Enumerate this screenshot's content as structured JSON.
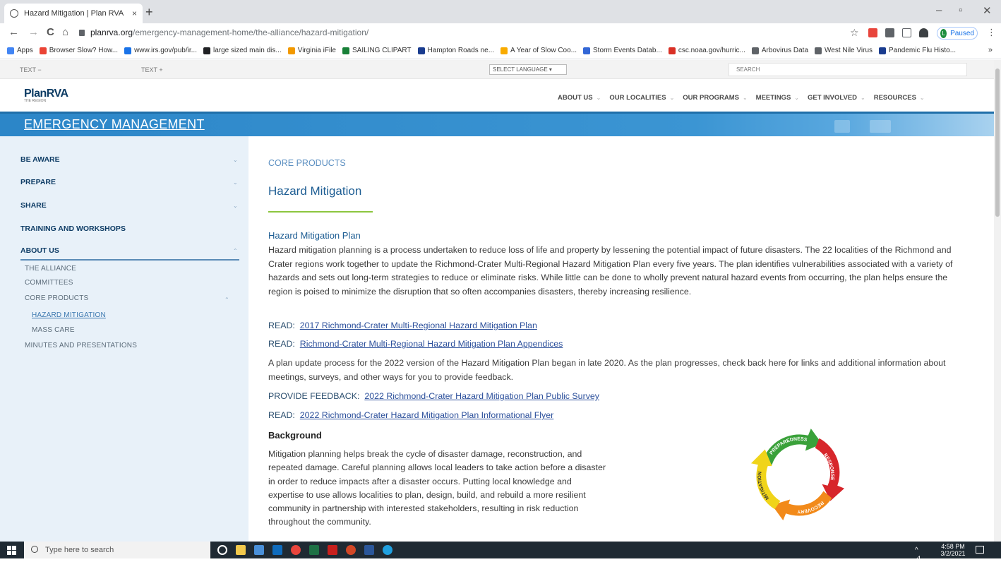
{
  "browser": {
    "tab_title": "Hazard Mitigation | Plan RVA",
    "tab_close": "×",
    "new_tab": "+",
    "window_controls": [
      "–",
      "▫",
      "✕"
    ],
    "nav": {
      "back": "←",
      "forward": "→",
      "reload": "C",
      "home": "⌂"
    },
    "url_host": "planrva.org",
    "url_path": "/emergency-management-home/the-alliance/hazard-mitigation/",
    "star": "☆",
    "profile_initial": "L",
    "profile_label": "Paused",
    "menu": "⋮",
    "bookmarks": [
      {
        "label": "Apps",
        "color": "#4285f4"
      },
      {
        "label": "Browser Slow? How...",
        "color": "#ea4335"
      },
      {
        "label": "www.irs.gov/pub/ir...",
        "color": "#1a73e8"
      },
      {
        "label": "large sized main dis...",
        "color": "#202124"
      },
      {
        "label": "Virginia iFile",
        "color": "#f29900"
      },
      {
        "label": "SAILING CLIPART",
        "color": "#188038"
      },
      {
        "label": "Hampton Roads ne...",
        "color": "#1a3c8f"
      },
      {
        "label": "A Year of Slow Coo...",
        "color": "#f9ab00"
      },
      {
        "label": "Storm Events Datab...",
        "color": "#3367d6"
      },
      {
        "label": "csc.noaa.gov/hurric...",
        "color": "#d93025"
      },
      {
        "label": "Arbovirus Data",
        "color": "#5f6368"
      },
      {
        "label": "West Nile Virus",
        "color": "#5f6368"
      },
      {
        "label": "Pandemic Flu Histo...",
        "color": "#1a3c8f"
      }
    ],
    "bookmarks_more": "»"
  },
  "utility": {
    "text_minus": "TEXT  −",
    "text_plus": "TEXT  +",
    "language": "SELECT LANGUAGE ▾",
    "search_placeholder": "SEARCH"
  },
  "header": {
    "logo": "PlanRVA",
    "logo_tagline": "THE REGION",
    "nav": [
      {
        "label": "ABOUT US",
        "caret": "⌄"
      },
      {
        "label": "OUR LOCALITIES",
        "caret": "⌄"
      },
      {
        "label": "OUR PROGRAMS",
        "caret": "⌄"
      },
      {
        "label": "MEETINGS",
        "caret": "⌄"
      },
      {
        "label": "GET INVOLVED",
        "caret": "⌄"
      },
      {
        "label": "RESOURCES",
        "caret": "⌄"
      }
    ]
  },
  "banner": {
    "title": "EMERGENCY MANAGEMENT"
  },
  "sidebar": {
    "sections": [
      {
        "label": "BE AWARE",
        "chevron": "⌄"
      },
      {
        "label": "PREPARE",
        "chevron": "⌄"
      },
      {
        "label": "SHARE",
        "chevron": "⌄"
      },
      {
        "label": "TRAINING AND WORKSHOPS",
        "chevron": ""
      },
      {
        "label": "ABOUT US",
        "chevron": "⌃"
      }
    ],
    "sub_items": [
      "THE ALLIANCE",
      "COMMITTEES",
      "CORE PRODUCTS",
      "MINUTES AND PRESENTATIONS"
    ],
    "core_chevron": "⌃",
    "core_children": [
      "HAZARD MITIGATION",
      "MASS CARE"
    ]
  },
  "main": {
    "kicker": "CORE PRODUCTS",
    "title": "Hazard Mitigation",
    "plan_heading": "Hazard Mitigation Plan",
    "plan_paragraph": "Hazard mitigation planning is a process undertaken to reduce loss of life and property by lessening the potential impact of future disasters.  The 22 localities of the Richmond and Crater regions work together to update the Richmond-Crater Multi-Regional Hazard Mitigation Plan every five years. The plan identifies vulnerabilities associated with a variety of hazards and sets out long-term strategies to reduce or eliminate risks. While little can be done to wholly prevent natural hazard events from occurring, the plan helps ensure the region is poised to minimize the disruption that so often accompanies disasters, thereby increasing resilience.",
    "links": [
      {
        "prefix": "READ:",
        "text": "2017 Richmond-Crater Multi-Regional Hazard Mitigation Plan"
      },
      {
        "prefix": "READ:",
        "text": "Richmond-Crater Multi-Regional Hazard Mitigation Plan Appendices"
      }
    ],
    "update_paragraph": "A plan update process for the 2022 version of the Hazard Mitigation Plan began in late 2020.  As the plan progresses, check back here for links and additional information about meetings, surveys, and other ways for you to provide feedback.",
    "links2": [
      {
        "prefix": "PROVIDE FEEDBACK:",
        "text": "2022 Richmond-Crater Hazard Mitigation Plan Public Survey"
      },
      {
        "prefix": "READ:",
        "text": "2022 Richmond-Crater Hazard Mitigation Plan Informational Flyer"
      }
    ],
    "background_heading": "Background",
    "background_paragraph": "Mitigation planning helps break the cycle of disaster damage, reconstruction, and repeated damage. Careful planning allows local leaders to take action before a disaster in order to reduce impacts after a disaster occurs. Putting local knowledge and expertise to use allows localities to plan, design, build, and rebuild a more resilient community in partnership with interested stakeholders, resulting in risk reduction throughout the community.",
    "cycle_labels": [
      "PREPAREDNESS",
      "RESPONSE",
      "RECOVERY",
      "MITIGATION"
    ]
  },
  "taskbar": {
    "search_placeholder": "Type here to search",
    "time": "4:58 PM",
    "date": "3/2/2021",
    "tray": "^ ⊿"
  }
}
